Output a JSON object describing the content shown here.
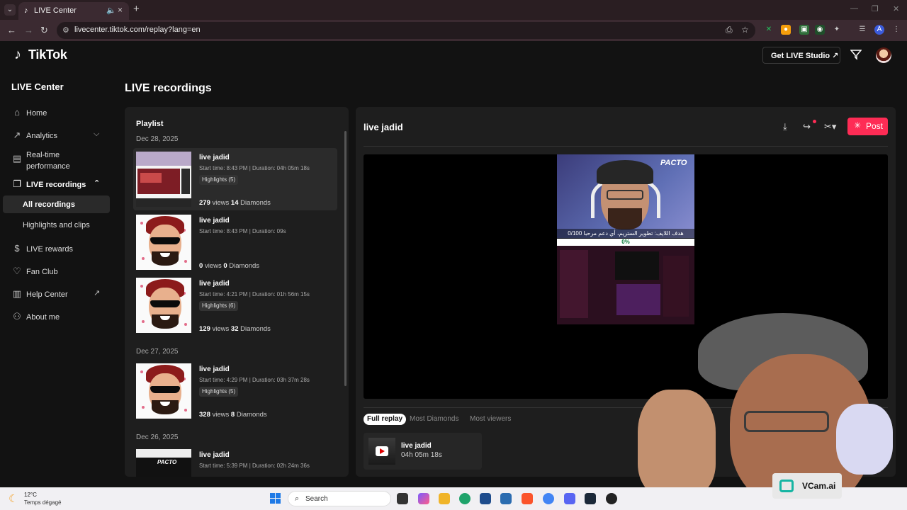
{
  "browser": {
    "tab_title": "LIVE Center",
    "url": "livecenter.tiktok.com/replay?lang=en"
  },
  "header": {
    "logo_text": "TikTok",
    "get_studio_label": "Get LIVE Studio ↗"
  },
  "sidebar": {
    "heading": "LIVE Center",
    "items": [
      {
        "label": "Home",
        "icon": "home-icon"
      },
      {
        "label": "Analytics",
        "icon": "analytics-icon"
      },
      {
        "label": "Real-time performance",
        "icon": "realtime-icon"
      },
      {
        "label": "LIVE recordings",
        "icon": "recordings-icon"
      },
      {
        "label": "LIVE rewards",
        "icon": "rewards-icon"
      },
      {
        "label": "Fan Club",
        "icon": "fan-club-icon"
      },
      {
        "label": "Help Center",
        "icon": "help-icon"
      },
      {
        "label": "About me",
        "icon": "user-icon"
      }
    ],
    "subitems": [
      {
        "label": "All recordings",
        "active": true
      },
      {
        "label": "Highlights and clips",
        "active": false
      }
    ]
  },
  "page": {
    "title": "LIVE recordings"
  },
  "playlist": {
    "title": "Playlist",
    "groups": [
      {
        "date": "Dec 28, 2025"
      },
      {
        "date": "Dec 27, 2025"
      },
      {
        "date": "Dec 26, 2025"
      }
    ],
    "recordings": [
      {
        "name": "live jadid",
        "meta": "Start time: 8:43 PM | Duration: 04h 05m 18s",
        "highlights": "Highlights (5)",
        "views": "279",
        "views_label": "views",
        "diamonds": "14",
        "diamonds_label": "Diamonds"
      },
      {
        "name": "live jadid",
        "meta": "Start time: 8:43 PM | Duration: 09s",
        "highlights": "",
        "views": "0",
        "views_label": "views",
        "diamonds": "0",
        "diamonds_label": "Diamonds"
      },
      {
        "name": "live jadid",
        "meta": "Start time: 4:21 PM | Duration: 01h 56m 15s",
        "highlights": "Highlights (6)",
        "views": "129",
        "views_label": "views",
        "diamonds": "32",
        "diamonds_label": "Diamonds"
      },
      {
        "name": "live jadid",
        "meta": "Start time: 4:29 PM | Duration: 03h 37m 28s",
        "highlights": "Highlights (5)",
        "views": "328",
        "views_label": "views",
        "diamonds": "8",
        "diamonds_label": "Diamonds"
      },
      {
        "name": "live jadid",
        "meta": "Start time: 5:39 PM | Duration: 02h 24m 36s",
        "highlights": "",
        "views": "",
        "views_label": "",
        "diamonds": "",
        "diamonds_label": ""
      }
    ]
  },
  "player": {
    "title": "live jadid",
    "post_label": "Post",
    "stream_brand": "PACTO",
    "goal_text": "0/100 هدف اللايف: تطوير الستريم، أي دعم مرحبا",
    "goal_percent": "0%",
    "tabs": [
      {
        "label": "Full replay",
        "active": true
      },
      {
        "label": "Most Diamonds",
        "active": false
      },
      {
        "label": "Most viewers",
        "active": false
      }
    ],
    "replay_item": {
      "name": "live jadid",
      "duration": "04h 05m 18s"
    }
  },
  "overlay": {
    "vcam_label": "VCam.ai"
  },
  "taskbar": {
    "temperature": "12°C",
    "condition": "Temps dégagé",
    "search_placeholder": "Search"
  },
  "colors": {
    "accent": "#fe2c55",
    "background": "#121212",
    "card": "#1e1e1e"
  }
}
